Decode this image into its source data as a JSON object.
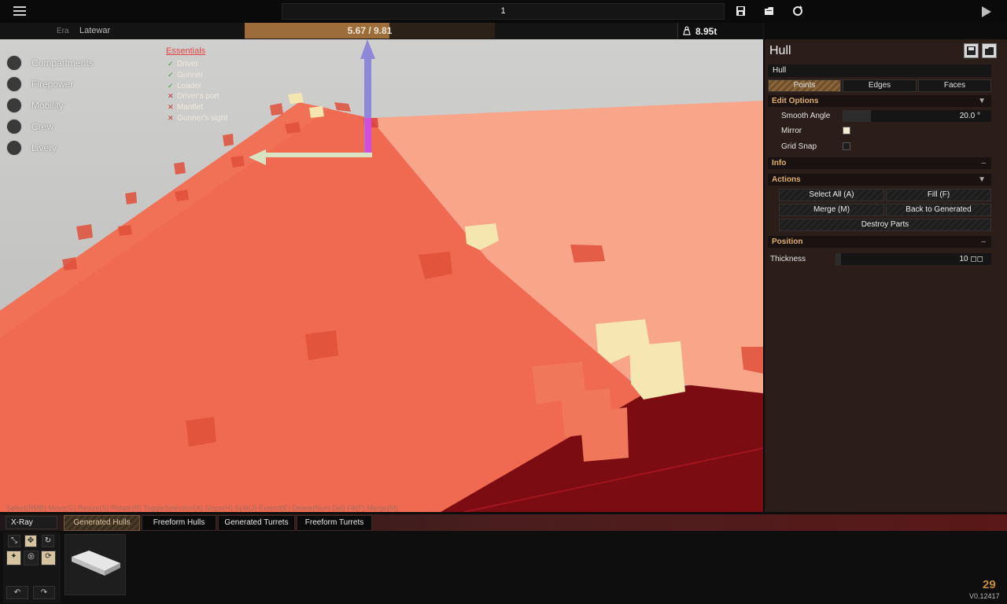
{
  "toolbar": {
    "menu_icon": "hamburger-menu-icon",
    "name_field_value": "1",
    "icons": [
      "save-icon",
      "open-icon",
      "refresh-icon",
      "play-icon"
    ]
  },
  "status": {
    "era_label": "Era",
    "era_value": "Latewar",
    "cost_text": "5.67 / 9.81",
    "cost_fraction": 0.578,
    "weight_icon": "weight-icon",
    "weight_text": "8.95t"
  },
  "nav": {
    "items": [
      {
        "label": "Compartments",
        "icon": "box-icon"
      },
      {
        "label": "Firepower",
        "icon": "cannon-icon"
      },
      {
        "label": "Mobility",
        "icon": "wheel-icon"
      },
      {
        "label": "Crew",
        "icon": "person-icon"
      },
      {
        "label": "Livery",
        "icon": "brush-icon"
      }
    ]
  },
  "essentials": {
    "title": "Essentials",
    "items": [
      {
        "label": "Driver",
        "status": "ok"
      },
      {
        "label": "Gunner",
        "status": "ok"
      },
      {
        "label": "Loader",
        "status": "ok"
      },
      {
        "label": "Driver's port",
        "status": "missing"
      },
      {
        "label": "Mantlet",
        "status": "missing"
      },
      {
        "label": "Gunner's sight",
        "status": "missing"
      }
    ]
  },
  "viewport": {
    "help_text": "Select(RMB) Move(G) Resize(S) Rotate(R) ToggleSelection(A) Slope(H) Split(J) Extend(E) Delete(Num Del) Fill(F) Merge(M)"
  },
  "panel": {
    "title": "Hull",
    "name_value": "Hull",
    "tabs": [
      "Points",
      "Edges",
      "Faces"
    ],
    "active_tab": "Points",
    "edit_options": {
      "title": "Edit Options",
      "toggle": "▼",
      "smooth_angle_label": "Smooth Angle",
      "smooth_angle_value": "20.0 °",
      "mirror_label": "Mirror",
      "mirror_checked": true,
      "grid_snap_label": "Grid Snap",
      "grid_snap_checked": false
    },
    "info": {
      "title": "Info",
      "toggle": "–"
    },
    "actions": {
      "title": "Actions",
      "toggle": "▼",
      "select_all": "Select All (A)",
      "fill": "Fill (F)",
      "merge": "Merge (M)",
      "back_to_generated": "Back to Generated",
      "destroy_parts": "Destroy Parts"
    },
    "position": {
      "title": "Position",
      "toggle": "–",
      "thickness_label": "Thickness",
      "thickness_value": "10 ◻◻"
    }
  },
  "bottom": {
    "xray_label": "X-Ray",
    "tabs": [
      "Generated Hulls",
      "Freeform Hulls",
      "Generated Turrets",
      "Freeform Turrets"
    ],
    "active_tab": "Generated Hulls",
    "tools": [
      "scale-icon",
      "move-icon",
      "rotate-icon",
      "magic-icon",
      "target-icon",
      "cycle-icon"
    ],
    "undo_label": "↶",
    "redo_label": "↷",
    "fps": "29",
    "version": "V0.12417"
  },
  "colors": {
    "accent": "#9c6d3a",
    "hull_red": "#f0694f",
    "hull_light": "#f7a386",
    "vertex": "#f6e7b2"
  }
}
